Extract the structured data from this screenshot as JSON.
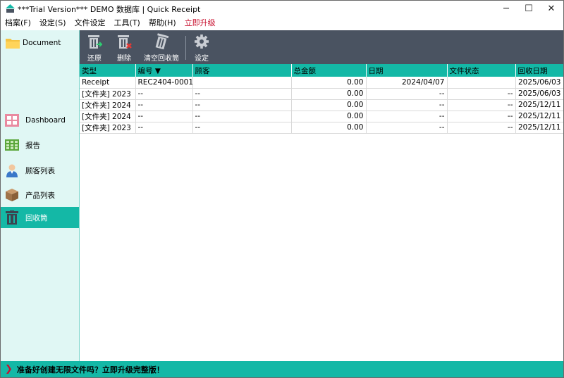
{
  "window": {
    "title": "***Trial Version*** DEMO 数据库 | Quick Receipt",
    "minimize": "─",
    "maximize": "☐",
    "close": "✕"
  },
  "menu": {
    "items": [
      "档案(F)",
      "设定(S)",
      "文件设定",
      "工具(T)",
      "帮助(H)"
    ],
    "upgrade": "立即升级"
  },
  "sidebar": {
    "document_label": "Document",
    "items": [
      {
        "label": "Dashboard",
        "icon": "dashboard-icon"
      },
      {
        "label": "报告",
        "icon": "report-icon"
      },
      {
        "label": "顾客列表",
        "icon": "customer-icon"
      },
      {
        "label": "产品列表",
        "icon": "product-icon"
      },
      {
        "label": "回收筒",
        "icon": "recycle-bin-icon",
        "active": true
      }
    ]
  },
  "toolbar": {
    "restore": "还原",
    "delete": "删除",
    "empty": "清空回收筒",
    "settings": "设定"
  },
  "table": {
    "columns": [
      "类型",
      "编号 ▼",
      "顾客",
      "总金额",
      "日期",
      "文件状态",
      "回收日期"
    ],
    "rows": [
      [
        "Receipt",
        "REC2404-0001",
        "",
        "0.00",
        "2024/04/07",
        "",
        "2025/06/03"
      ],
      [
        "[文件夹] 2023",
        "--",
        "--",
        "0.00",
        "--",
        "--",
        "2025/06/03"
      ],
      [
        "[文件夹] 2024",
        "--",
        "--",
        "0.00",
        "--",
        "--",
        "2025/12/11"
      ],
      [
        "[文件夹] 2024",
        "--",
        "--",
        "0.00",
        "--",
        "--",
        "2025/12/11"
      ],
      [
        "[文件夹] 2023",
        "--",
        "--",
        "0.00",
        "--",
        "--",
        "2025/12/11"
      ]
    ]
  },
  "banner": {
    "text": "准备好创建无限文件吗？立即升级完整版！"
  },
  "colors": {
    "accent": "#14b8a6",
    "sidebar_bg": "#e0f7f4",
    "toolbar_bg": "#4a5361",
    "upgrade": "#c8102e"
  }
}
